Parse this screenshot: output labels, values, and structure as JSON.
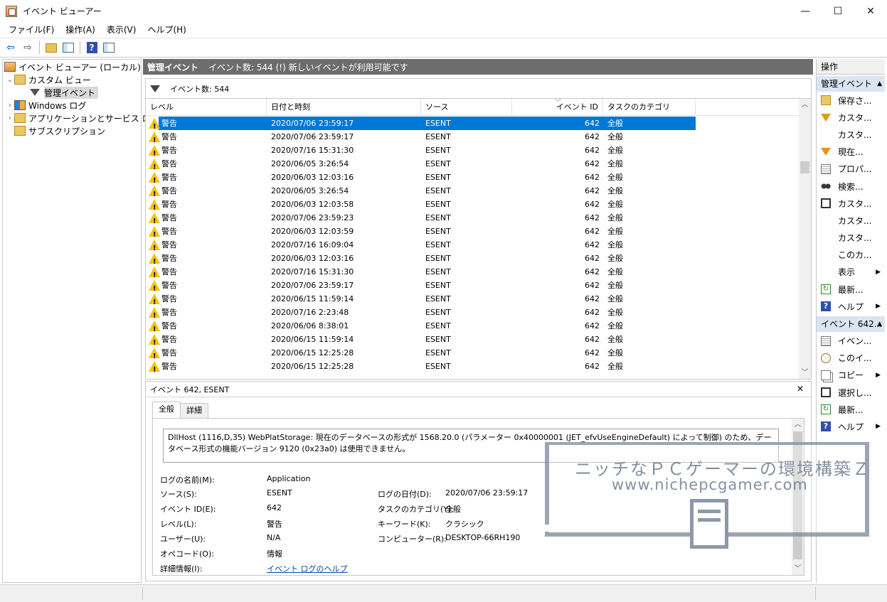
{
  "window": {
    "title": "イベント ビューアー",
    "minimize": "—",
    "maximize": "☐",
    "close": "✕"
  },
  "menu": [
    "ファイル(F)",
    "操作(A)",
    "表示(V)",
    "ヘルプ(H)"
  ],
  "tree": {
    "root": "イベント ビューアー (ローカル)",
    "custom_views": "カスタム ビュー",
    "admin_events": "管理イベント",
    "windows_logs": "Windows ログ",
    "app_service_logs": "アプリケーションとサービス ログ",
    "subscriptions": "サブスクリプション"
  },
  "middle": {
    "header_title": "管理イベント",
    "header_info": "イベント数: 544 (!) 新しいイベントが利用可能です",
    "filter_text": "イベント数: 544",
    "columns": {
      "level": "レベル",
      "date": "日付と時刻",
      "source": "ソース",
      "event_id": "イベント ID",
      "task": "タスクのカテゴリ"
    },
    "rows": [
      {
        "level": "警告",
        "date": "2020/07/06 23:59:17",
        "source": "ESENT",
        "id": "642",
        "task": "全般"
      },
      {
        "level": "警告",
        "date": "2020/07/06 23:59:17",
        "source": "ESENT",
        "id": "642",
        "task": "全般"
      },
      {
        "level": "警告",
        "date": "2020/07/16 15:31:30",
        "source": "ESENT",
        "id": "642",
        "task": "全般"
      },
      {
        "level": "警告",
        "date": "2020/06/05 3:26:54",
        "source": "ESENT",
        "id": "642",
        "task": "全般"
      },
      {
        "level": "警告",
        "date": "2020/06/03 12:03:16",
        "source": "ESENT",
        "id": "642",
        "task": "全般"
      },
      {
        "level": "警告",
        "date": "2020/06/05 3:26:54",
        "source": "ESENT",
        "id": "642",
        "task": "全般"
      },
      {
        "level": "警告",
        "date": "2020/06/03 12:03:58",
        "source": "ESENT",
        "id": "642",
        "task": "全般"
      },
      {
        "level": "警告",
        "date": "2020/07/06 23:59:23",
        "source": "ESENT",
        "id": "642",
        "task": "全般"
      },
      {
        "level": "警告",
        "date": "2020/06/03 12:03:59",
        "source": "ESENT",
        "id": "642",
        "task": "全般"
      },
      {
        "level": "警告",
        "date": "2020/07/16 16:09:04",
        "source": "ESENT",
        "id": "642",
        "task": "全般"
      },
      {
        "level": "警告",
        "date": "2020/06/03 12:03:16",
        "source": "ESENT",
        "id": "642",
        "task": "全般"
      },
      {
        "level": "警告",
        "date": "2020/07/16 15:31:30",
        "source": "ESENT",
        "id": "642",
        "task": "全般"
      },
      {
        "level": "警告",
        "date": "2020/07/06 23:59:17",
        "source": "ESENT",
        "id": "642",
        "task": "全般"
      },
      {
        "level": "警告",
        "date": "2020/06/15 11:59:14",
        "source": "ESENT",
        "id": "642",
        "task": "全般"
      },
      {
        "level": "警告",
        "date": "2020/07/16 2:23:48",
        "source": "ESENT",
        "id": "642",
        "task": "全般"
      },
      {
        "level": "警告",
        "date": "2020/06/06 8:38:01",
        "source": "ESENT",
        "id": "642",
        "task": "全般"
      },
      {
        "level": "警告",
        "date": "2020/06/15 11:59:14",
        "source": "ESENT",
        "id": "642",
        "task": "全般"
      },
      {
        "level": "警告",
        "date": "2020/06/15 12:25:28",
        "source": "ESENT",
        "id": "642",
        "task": "全般"
      },
      {
        "level": "警告",
        "date": "2020/06/15 12:25:28",
        "source": "ESENT",
        "id": "642",
        "task": "全般"
      }
    ],
    "selected_row": 0
  },
  "detail": {
    "title": "イベント 642, ESENT",
    "tab_general": "全般",
    "tab_details": "詳細",
    "description": "DllHost (1116,D,35) WebPlatStorage: 現在のデータベースの形式が 1568.20.0 (パラメーター 0x40000001 (JET_efvUseEngineDefault) によって制御) のため、データベース形式の機能バージョン 9120 (0x23a0) は使用できません。",
    "labels": {
      "log_name": "ログの名前(M):",
      "source": "ソース(S):",
      "event_id": "イベント ID(E):",
      "level": "レベル(L):",
      "user": "ユーザー(U):",
      "opcode": "オペコード(O):",
      "more_info": "詳細情報(I):",
      "logged": "ログの日付(D):",
      "task": "タスクのカテゴリ(Y):",
      "keywords": "キーワード(K):",
      "computer": "コンピューター(R):"
    },
    "values": {
      "log_name": "Application",
      "source": "ESENT",
      "event_id": "642",
      "level": "警告",
      "user": "N/A",
      "opcode": "情報",
      "more_info": "イベント ログのヘルプ",
      "logged": "2020/07/06 23:59:17",
      "task": "全般",
      "keywords": "クラシック",
      "computer": "DESKTOP-66RH190"
    }
  },
  "actions": {
    "title": "操作",
    "section1": "管理イベント",
    "items1": [
      {
        "label": "保存さ...",
        "icon": "open-icon"
      },
      {
        "label": "カスタ...",
        "icon": "filter-icon"
      },
      {
        "label": "カスタ...",
        "icon": "blank-icon"
      },
      {
        "label": "現在...",
        "icon": "filter-icon"
      },
      {
        "label": "プロパ...",
        "icon": "properties-icon"
      },
      {
        "label": "検索...",
        "icon": "find-icon"
      },
      {
        "label": "カスタ...",
        "icon": "save-icon"
      },
      {
        "label": "カスタ...",
        "icon": "blank-icon"
      },
      {
        "label": "カスタ...",
        "icon": "blank-icon"
      },
      {
        "label": "このカ...",
        "icon": "blank-icon"
      },
      {
        "label": "表示",
        "icon": "blank-icon",
        "submenu": true
      },
      {
        "label": "最新...",
        "icon": "refresh-icon"
      },
      {
        "label": "ヘルプ",
        "icon": "help-icon",
        "submenu": true
      }
    ],
    "section2": "イベント 642...",
    "items2": [
      {
        "label": "イベン...",
        "icon": "properties-icon"
      },
      {
        "label": "このイ...",
        "icon": "clock-icon"
      },
      {
        "label": "コピー",
        "icon": "copy-icon",
        "submenu": true
      },
      {
        "label": "選択し...",
        "icon": "save-icon"
      },
      {
        "label": "最新...",
        "icon": "refresh-icon"
      },
      {
        "label": "ヘルプ",
        "icon": "help-icon",
        "submenu": true
      }
    ]
  },
  "watermark": {
    "line1": "ニッチなＰＣゲーマーの環境構築Ｚ",
    "line2": "www.nichepcgamer.com"
  }
}
